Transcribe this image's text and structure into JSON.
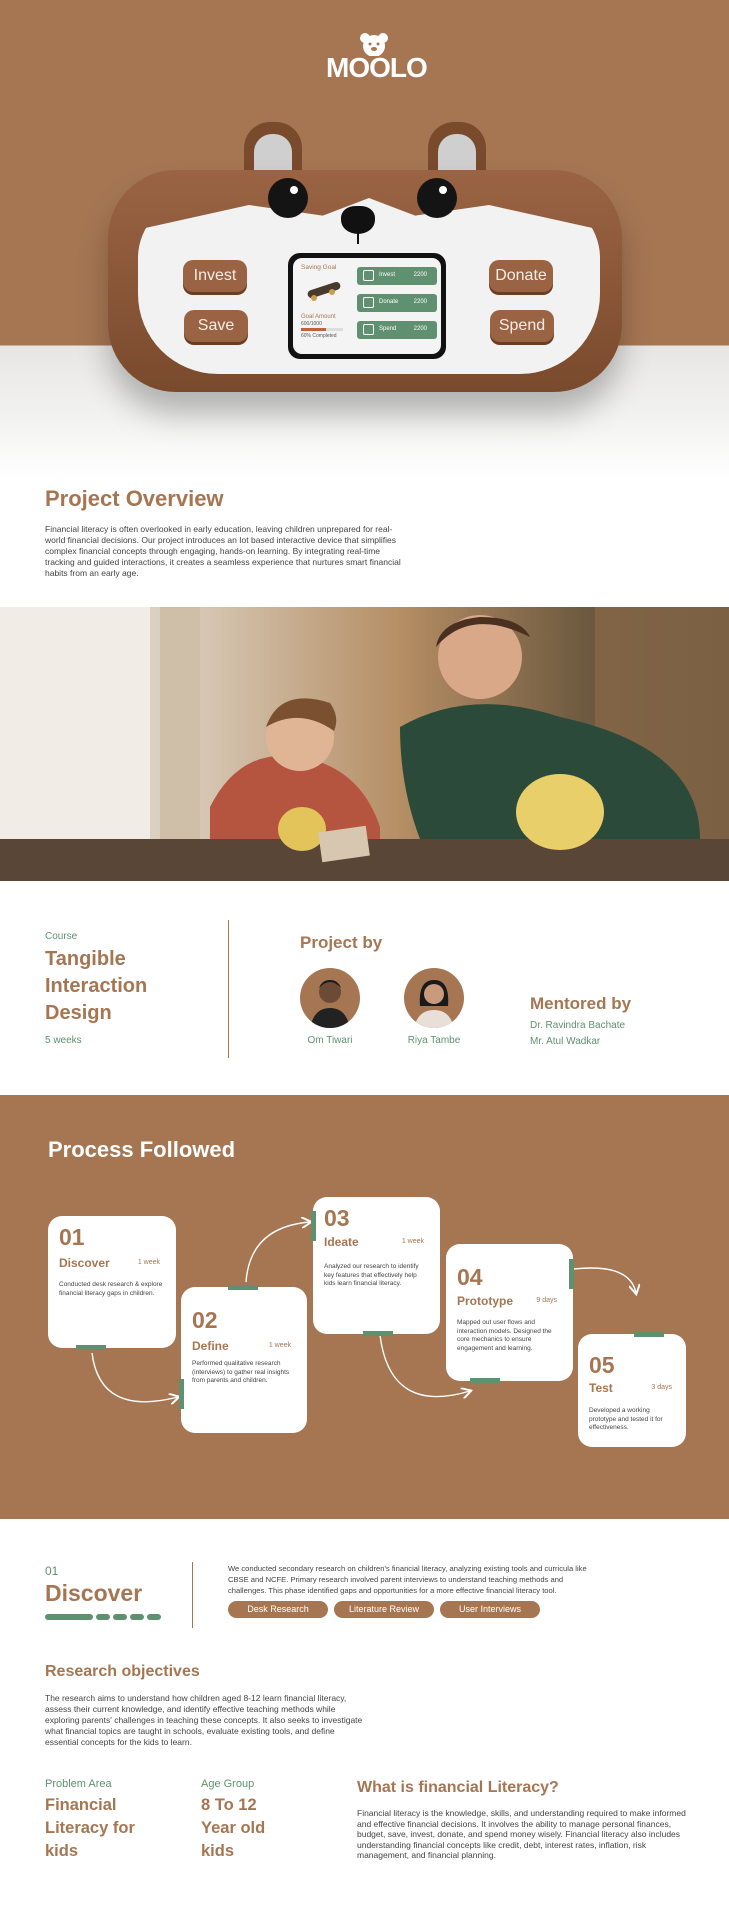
{
  "brand": {
    "logo_text": "MOOLO"
  },
  "device": {
    "buttons": {
      "invest": "Invest",
      "save": "Save",
      "donate": "Donate",
      "spend": "Spend"
    },
    "screen": {
      "saving_goal_label": "Saving Goal",
      "goal_amount_label": "Goal Amount",
      "goal_amount_value": "600/1000",
      "goal_progress_percent": 60,
      "completed_label": "60% Completed",
      "rows": [
        {
          "label": "Invest",
          "value": "2200"
        },
        {
          "label": "Donate",
          "value": "2200"
        },
        {
          "label": "Spend",
          "value": "2200"
        }
      ]
    }
  },
  "overview": {
    "title": "Project Overview",
    "text": "Financial literacy is often overlooked in early education, leaving children unprepared for real-world financial decisions. Our project introduces an Iot based interactive device that simplifies complex financial concepts through engaging, hands-on learning. By integrating real-time tracking and guided interactions, it creates a seamless experience that nurtures smart financial habits from an early age."
  },
  "course": {
    "label": "Course",
    "title": "Tangible Interaction Design",
    "duration": "5 weeks"
  },
  "team": {
    "project_by_title": "Project by",
    "members": [
      {
        "name": "Om Tiwari"
      },
      {
        "name": "Riya Tambe"
      }
    ],
    "mentored_title": "Mentored by",
    "mentors": [
      "Dr. Ravindra Bachate",
      "Mr. Atul Wadkar"
    ]
  },
  "process": {
    "title": "Process Followed",
    "steps": [
      {
        "num": "01",
        "title": "Discover",
        "duration": "1 week",
        "desc": "Conducted desk research & explore financial literacy gaps in children."
      },
      {
        "num": "02",
        "title": "Define",
        "duration": "1 week",
        "desc": "Performed qualitative research (interviews) to gather real insights from parents and children."
      },
      {
        "num": "03",
        "title": "Ideate",
        "duration": "1 week",
        "desc": "Analyzed our research to identify key features that effectively help kids learn financial literacy."
      },
      {
        "num": "04",
        "title": "Prototype",
        "duration": "9 days",
        "desc": "Mapped out user flows and interaction models. Designed the core mechanics to ensure engagement and learning."
      },
      {
        "num": "05",
        "title": "Test",
        "duration": "3 days",
        "desc": "Developed a working prototype and tested it for effectiveness."
      }
    ]
  },
  "discover": {
    "num": "01",
    "title": "Discover",
    "text": "We conducted secondary research on children's financial literacy, analyzing existing tools and curricula like CBSE and NCFE. Primary research involved parent interviews to understand teaching methods and challenges. This phase identified gaps and opportunities for a more effective financial literacy tool.",
    "pills": [
      "Desk Research",
      "Literature Review",
      "User Interviews"
    ]
  },
  "research": {
    "title": "Research objectives",
    "text": "The research aims to understand how children aged 8-12 learn financial literacy, assess their current knowledge, and identify effective teaching methods while exploring parents' challenges in teaching these concepts. It also seeks to investigate what financial topics are taught in schools, evaluate existing tools, and define essential concepts for the kids to learn."
  },
  "problem": {
    "label": "Problem Area",
    "value": "Financial Literacy for kids"
  },
  "age": {
    "label": "Age Group",
    "value": "8 To 12 Year old kids"
  },
  "financial_literacy": {
    "title": "What is financial Literacy?",
    "text": "Financial literacy is the knowledge, skills, and understanding required to make informed and effective financial decisions. It involves the ability to manage personal finances, budget, save, invest, donate, and spend money wisely. Financial literacy also includes understanding financial concepts like credit, debt, interest rates, inflation, risk management, and financial planning."
  }
}
